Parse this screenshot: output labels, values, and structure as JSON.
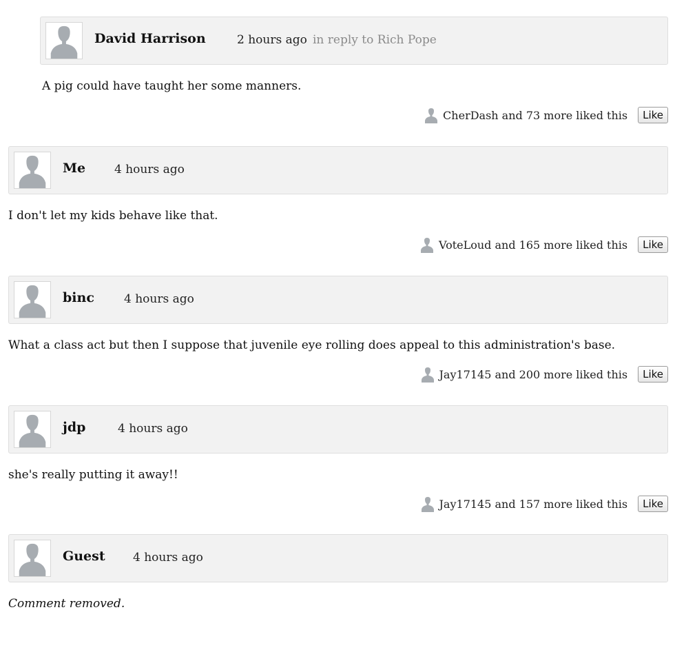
{
  "comments": [
    {
      "author": "David Harrison",
      "time": "2 hours ago",
      "reply_to": "in reply to Rich Pope",
      "body": "A pig could have taught her some manners.",
      "likes_text": "CherDash and 73 more liked this",
      "like_button": "Like"
    },
    {
      "author": "Me",
      "time": "4 hours ago",
      "body": "I don't let my kids behave like that.",
      "likes_text": "VoteLoud and 165 more liked this",
      "like_button": "Like"
    },
    {
      "author": "binc",
      "time": "4 hours ago",
      "body": "What a class act but then I suppose that juvenile eye rolling does appeal to this administration's base.",
      "likes_text": "Jay17145 and 200 more liked this",
      "like_button": "Like"
    },
    {
      "author": "jdp",
      "time": "4 hours ago",
      "body": "she's really putting it away!!",
      "likes_text": "Jay17145 and 157 more liked this",
      "like_button": "Like"
    },
    {
      "author": "Guest",
      "time": "4 hours ago",
      "body": "Comment removed."
    }
  ],
  "colors": {
    "header_bg": "#f2f2f2",
    "avatar_silhouette": "#a7acb1",
    "reply_text": "#8a8a8a"
  },
  "icons": {
    "avatar": "default-avatar-silhouette-icon"
  }
}
